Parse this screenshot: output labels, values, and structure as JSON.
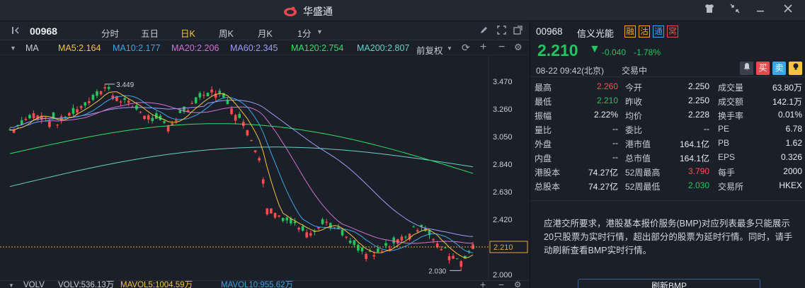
{
  "window": {
    "app_title": "华盛通",
    "controls": [
      "shirt-icon",
      "collapse-icon",
      "minimize-icon",
      "close-icon"
    ]
  },
  "toolbar": {
    "code": "00968",
    "periods": [
      "分时",
      "五日",
      "日K",
      "周K",
      "月K",
      "1分"
    ],
    "active_period": "日K"
  },
  "ma_legend": {
    "label": "MA",
    "items": [
      {
        "text": "MA5:2.164",
        "color": "#f5c242"
      },
      {
        "text": "MA10:2.177",
        "color": "#3aa7e8"
      },
      {
        "text": "MA20:2.206",
        "color": "#d36fd6"
      },
      {
        "text": "MA60:2.345",
        "color": "#9e9dfa"
      },
      {
        "text": "MA120:2.754",
        "color": "#2ee06a"
      },
      {
        "text": "MA200:2.807",
        "color": "#64d1c7"
      }
    ],
    "adjust": "前复权"
  },
  "chart_data": {
    "type": "candlestick",
    "y_ticks": [
      "3.470",
      "3.260",
      "3.050",
      "2.840",
      "2.630",
      "2.420",
      "2.210",
      "2.000"
    ],
    "ylim": [
      2.0,
      3.47
    ],
    "current_price_label": "2.210",
    "high_marker": "3.449",
    "low_marker": "2.030"
  },
  "volume_legend": {
    "label": "VOLV",
    "items": [
      {
        "text": "VOLV:536.13万",
        "color": "#c8cdd6"
      },
      {
        "text": "MAVOL5:1004.59万",
        "color": "#f5c242"
      },
      {
        "text": "MAVOL10:955.62万",
        "color": "#3aa7e8"
      }
    ]
  },
  "quote": {
    "code": "00968",
    "name": "信义光能",
    "tags": [
      {
        "text": "融",
        "color": "#f5a623"
      },
      {
        "text": "沽",
        "color": "#f5a623"
      },
      {
        "text": "通",
        "color": "#3aa7e8"
      },
      {
        "text": "窝",
        "color": "#e5484d"
      }
    ],
    "price": "2.210",
    "change": "-0.040",
    "change_pct": "-1.78%",
    "time": "08-22  09:42(北京)",
    "status": "交易中",
    "buttons": [
      {
        "text": "买",
        "bg": "#e5484d"
      },
      {
        "text": "卖",
        "bg": "#3aa7e8"
      }
    ],
    "stats": [
      [
        {
          "label": "最高",
          "value": "2.260",
          "color": "#ff4d4f"
        },
        {
          "label": "今开",
          "value": "2.250",
          "color": "#e8ebf0"
        },
        {
          "label": "成交量",
          "value": "63.80万",
          "color": "#e8ebf0"
        }
      ],
      [
        {
          "label": "最低",
          "value": "2.210",
          "color": "#22c55e"
        },
        {
          "label": "昨收",
          "value": "2.250",
          "color": "#e8ebf0"
        },
        {
          "label": "成交额",
          "value": "142.1万",
          "color": "#e8ebf0"
        }
      ],
      [
        {
          "label": "振幅",
          "value": "2.22%",
          "color": "#e8ebf0"
        },
        {
          "label": "均价",
          "value": "2.228",
          "color": "#e8ebf0"
        },
        {
          "label": "换手率",
          "value": "0.01%",
          "color": "#e8ebf0"
        }
      ],
      [
        {
          "label": "量比",
          "value": "--",
          "color": "#e8ebf0"
        },
        {
          "label": "委比",
          "value": "--",
          "color": "#e8ebf0"
        },
        {
          "label": "PE",
          "value": "6.78",
          "color": "#e8ebf0"
        }
      ],
      [
        {
          "label": "外盘",
          "value": "--",
          "color": "#e8ebf0"
        },
        {
          "label": "港市值",
          "value": "164.1亿",
          "color": "#e8ebf0"
        },
        {
          "label": "PB",
          "value": "1.62",
          "color": "#e8ebf0"
        }
      ],
      [
        {
          "label": "内盘",
          "value": "--",
          "color": "#e8ebf0"
        },
        {
          "label": "总市值",
          "value": "164.1亿",
          "color": "#e8ebf0"
        },
        {
          "label": "EPS",
          "value": "0.326",
          "color": "#e8ebf0"
        }
      ],
      [
        {
          "label": "港股本",
          "value": "74.27亿",
          "color": "#e8ebf0"
        },
        {
          "label": "52周最高",
          "value": "3.790",
          "color": "#ff4d4f"
        },
        {
          "label": "每手",
          "value": "2000",
          "color": "#e8ebf0"
        }
      ],
      [
        {
          "label": "总股本",
          "value": "74.27亿",
          "color": "#e8ebf0"
        },
        {
          "label": "52周最低",
          "value": "2.030",
          "color": "#22c55e"
        },
        {
          "label": "交易所",
          "value": "HKEX",
          "color": "#e8ebf0"
        }
      ]
    ]
  },
  "notice": {
    "text": "应港交所要求，港股基本报价服务(BMP)对应列表最多只能展示20只股票为实时行情，超出部分的股票为延时行情。同时，请手动刷新查看BMP实时行情。",
    "button": "刷新BMP"
  }
}
